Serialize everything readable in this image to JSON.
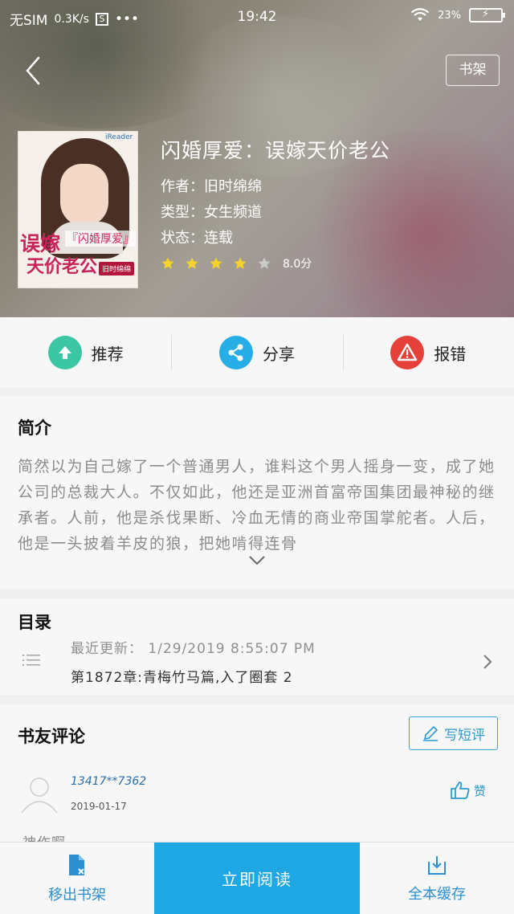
{
  "status_bar": {
    "carrier": "无SIM",
    "net_speed": "0.3K/s",
    "sim_icon_label": "S",
    "time": "19:42",
    "battery_text": "23%"
  },
  "header": {
    "back_icon": "chevron-left-icon",
    "shelf_label": "书架"
  },
  "book": {
    "title": "闪婚厚爱：误嫁天价老公",
    "author": "作者：旧时绵绵",
    "category": "类型：女生频道",
    "status": "状态：连载",
    "rating": 4,
    "rating_max": 5,
    "score": "8.0分",
    "cover_text": {
      "logo": "iReader",
      "line1": "误嫁",
      "line2": "『闪婚厚爱』",
      "line3": "天价老公",
      "author_tag": "旧时绵绵"
    }
  },
  "actions": [
    {
      "label": "推荐",
      "icon": "upload-arrow-icon",
      "color": "#3bc6a4"
    },
    {
      "label": "分享",
      "icon": "share-icon",
      "color": "#27aee6"
    },
    {
      "label": "报错",
      "icon": "warning-icon",
      "color": "#e5413a"
    }
  ],
  "intro": {
    "title": "简介",
    "text": "简然以为自己嫁了一个普通男人，谁料这个男人摇身一变，成了她公司的总裁大人。不仅如此，他还是亚洲首富帝国集团最神秘的继承者。人前，他是杀伐果断、冷血无情的商业帝国掌舵者。人后，他是一头披着羊皮的狼，把她啃得连骨"
  },
  "toc": {
    "title": "目录",
    "last_update": "最近更新： 1/29/2019 8:55:07 PM",
    "latest_chapter": "第1872章:青梅竹马篇,入了圈套 2"
  },
  "reviews": {
    "title": "书友评论",
    "write_label": "写短评",
    "items": [
      {
        "user": "13417**7362",
        "date": "2019-01-17",
        "like_label": "赞",
        "text": "神作啊"
      }
    ]
  },
  "bottom_bar": {
    "remove_label": "移出书架",
    "read_label": "立即阅读",
    "cache_label": "全本缓存"
  },
  "colors": {
    "accent": "#1fa7e4",
    "star": "#f5d327"
  }
}
